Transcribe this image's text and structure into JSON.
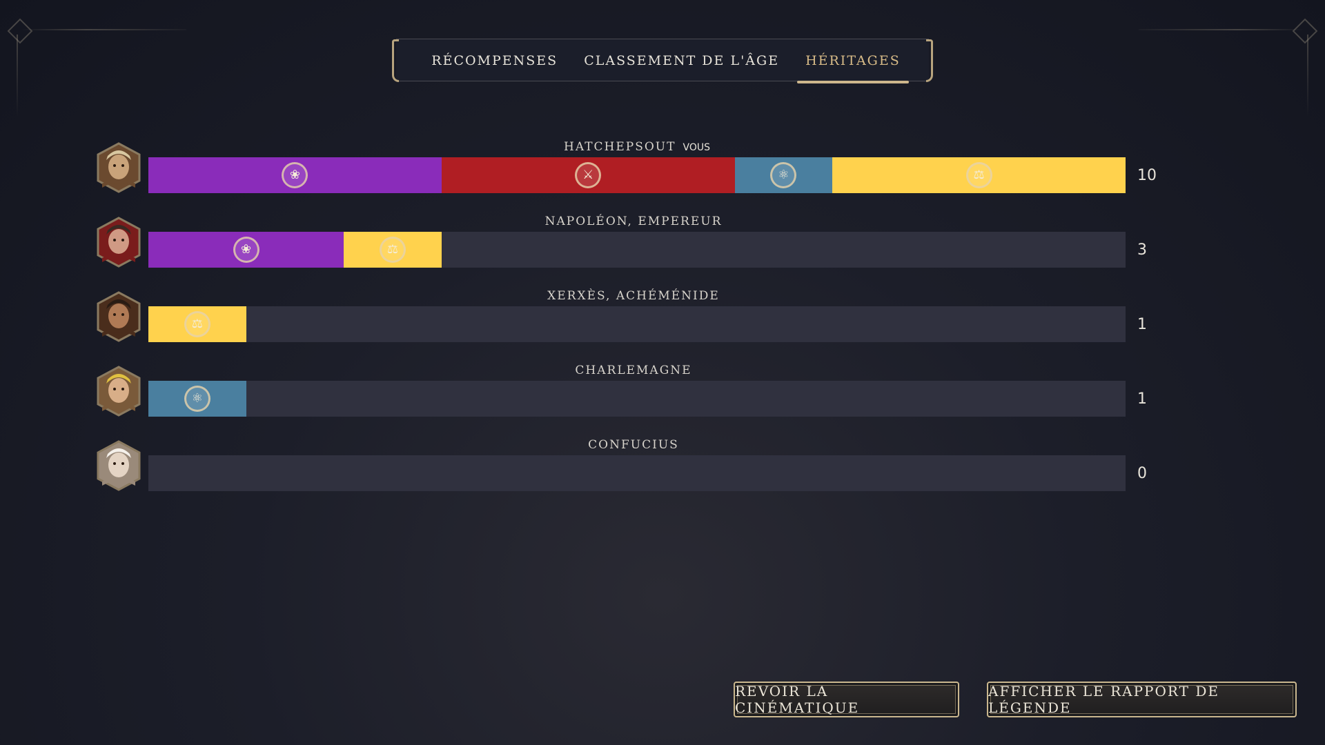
{
  "tabs": [
    {
      "label": "RÉCOMPENSES",
      "active": false
    },
    {
      "label": "CLASSEMENT DE L'ÂGE",
      "active": false
    },
    {
      "label": "HÉRITAGES",
      "active": true
    }
  ],
  "legacy_colors": {
    "culture": "#8a2cba",
    "military": "#b01e23",
    "science": "#4a7f9f",
    "economic": "#ffd24d"
  },
  "players": [
    {
      "name": "HATCHEPSOUT",
      "you_tag": "VOUS",
      "score": "10",
      "segments": [
        {
          "type": "culture",
          "points": 3
        },
        {
          "type": "military",
          "points": 3
        },
        {
          "type": "science",
          "points": 1
        },
        {
          "type": "economic",
          "points": 3
        }
      ]
    },
    {
      "name": "NAPOLÉON, EMPEREUR",
      "you_tag": "",
      "score": "3",
      "segments": [
        {
          "type": "culture",
          "points": 2
        },
        {
          "type": "economic",
          "points": 1
        }
      ]
    },
    {
      "name": "XERXÈS, ACHÉMÉNIDE",
      "you_tag": "",
      "score": "1",
      "segments": [
        {
          "type": "economic",
          "points": 1
        }
      ]
    },
    {
      "name": "CHARLEMAGNE",
      "you_tag": "",
      "score": "1",
      "segments": [
        {
          "type": "science",
          "points": 1
        }
      ]
    },
    {
      "name": "CONFUCIUS",
      "you_tag": "",
      "score": "0",
      "segments": []
    }
  ],
  "max_points": 10,
  "buttons": {
    "replay": "REVOIR LA CINÉMATIQUE",
    "report": "AFFICHER LE RAPPORT DE LÉGENDE"
  }
}
